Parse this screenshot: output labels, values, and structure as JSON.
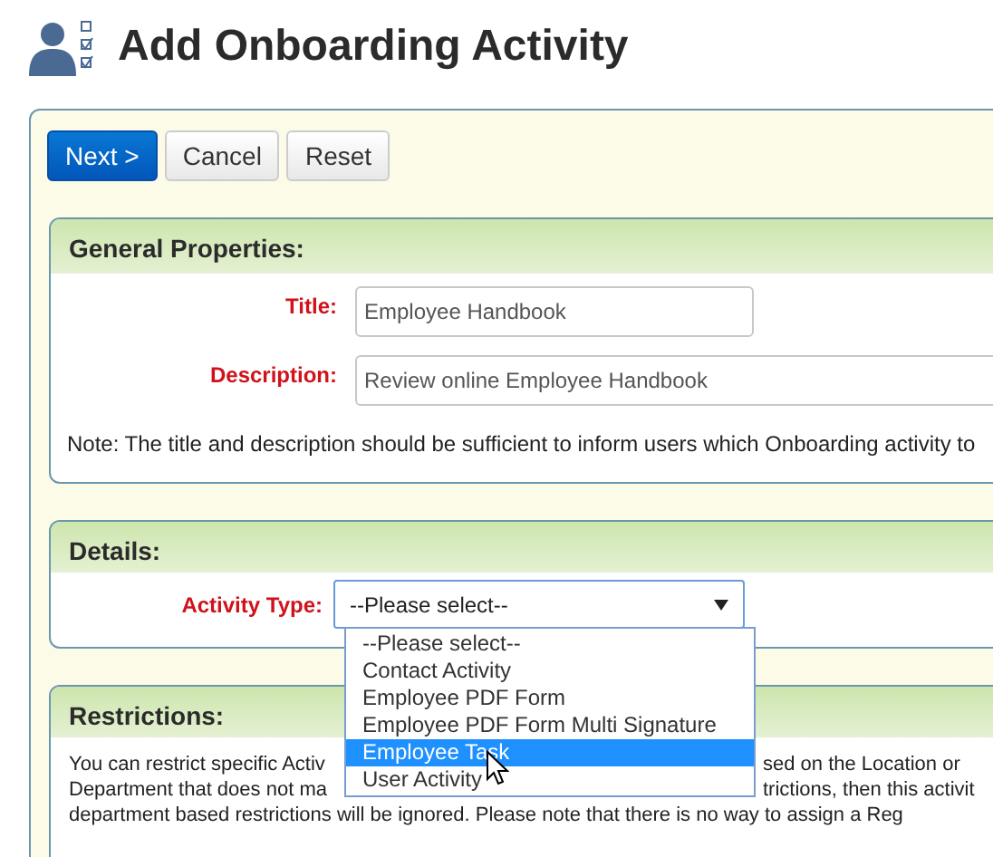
{
  "page": {
    "title": "Add Onboarding Activity"
  },
  "buttons": [
    {
      "label": "Next >",
      "kind": "primary"
    },
    {
      "label": "Cancel",
      "kind": "default"
    },
    {
      "label": "Reset",
      "kind": "default"
    }
  ],
  "general_properties": {
    "heading": "General Properties:",
    "fields": [
      {
        "label": "Title:",
        "value": "Employee Handbook",
        "required": true,
        "kind": "short"
      },
      {
        "label": "Description:",
        "value": "Review online Employee Handbook",
        "required": true,
        "kind": "long"
      }
    ],
    "note": "Note: The title and description should be sufficient to inform users which Onboarding activity to"
  },
  "details": {
    "heading": "Details:",
    "activity_type": {
      "label": "Activity Type:",
      "required": true,
      "value": "--Please select--",
      "expanded": true,
      "options": [
        {
          "label": "--Please select--",
          "highlighted": false
        },
        {
          "label": "Contact Activity",
          "highlighted": false
        },
        {
          "label": "Employee PDF Form",
          "highlighted": false
        },
        {
          "label": "Employee PDF Form Multi Signature",
          "highlighted": false
        },
        {
          "label": "Employee Task",
          "highlighted": true
        },
        {
          "label": "User Activity",
          "highlighted": false
        }
      ]
    }
  },
  "restrictions": {
    "heading": "Restrictions:",
    "lines": [
      {
        "left": "You can restrict specific Activ",
        "right": "sed on the Location or"
      },
      {
        "left": "Department that does not ma",
        "right": "trictions, then this activit"
      },
      {
        "left": "department based restrictions will be ignored. Please note that there is no way to assign a Reg"
      }
    ]
  }
}
